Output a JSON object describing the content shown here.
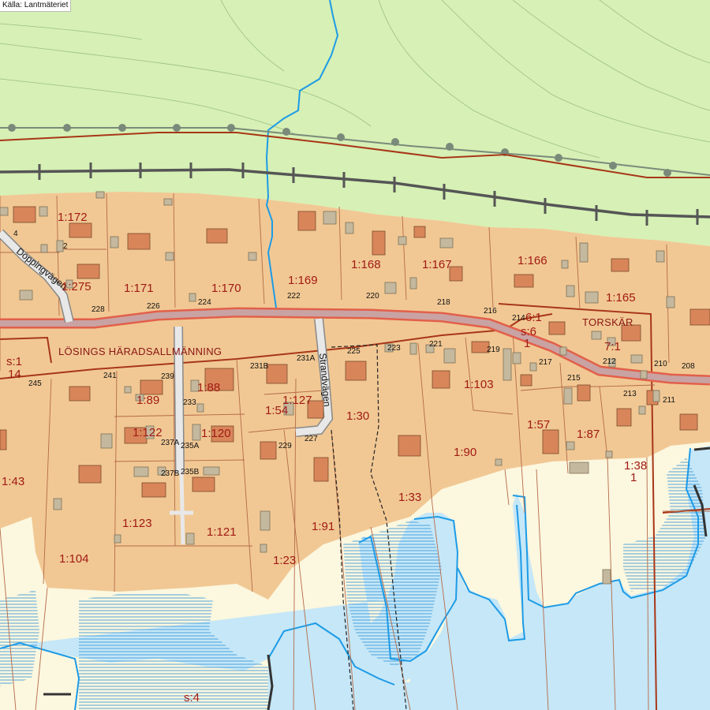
{
  "source_label": "Källa: Lantmäteriet",
  "colors": {
    "forest": "#d6f0b5",
    "plot": "#f1c894",
    "open_land": "#fcf7df",
    "water": "#c5e7f7",
    "stream": "#1d9be6",
    "main_road_fill": "#c9a3a3",
    "main_road_casing": "#e2604a",
    "boundary": "#a83618",
    "parcel_label": "#a01a14",
    "building": "#d9855a",
    "outbuilding": "#c4b89e"
  },
  "roads": {
    "doppingvagen": "Doppingvägen",
    "strandvagen": "Strandvägen"
  },
  "place_names": {
    "losings": "LÖSINGS HÄRADSALLMÄNNING",
    "torskar": "TORSKÄR"
  },
  "parcels": {
    "p172": "1:172",
    "p275": "1:275",
    "p171": "1:171",
    "p170": "1:170",
    "p169": "1:169",
    "p168": "1:168",
    "p167": "1:167",
    "p166": "1:166",
    "p165": "1:165",
    "p61": "6:1",
    "s6": "s:6",
    "s6_line2": "1",
    "p71": "7:1",
    "s1": "s:1",
    "s1_line2": "14",
    "p89": "1:89",
    "p88": "1:88",
    "p54": "1:54",
    "p127": "1:127",
    "p30": "1:30",
    "p103": "1:103",
    "p57": "1:57",
    "p87": "1:87",
    "p43": "1:43",
    "p122": "1:122",
    "p120": "1:120",
    "p90": "1:90",
    "p38": "1:38",
    "p38_line2": "1",
    "p33": "1:33",
    "p123": "1:123",
    "p121": "1:121",
    "p91": "1:91",
    "p104": "1:104",
    "p23": "1:23",
    "s4": "s:4"
  },
  "addresses": {
    "a4": "4",
    "a2": "2",
    "a228": "228",
    "a226": "226",
    "a224": "224",
    "a222": "222",
    "a220": "220",
    "a218": "218",
    "a216": "216",
    "a214": "214",
    "a212": "212",
    "a210": "210",
    "a208": "208",
    "a225": "225",
    "a223": "223",
    "a221": "221",
    "a219": "219",
    "a217": "217",
    "a215": "215",
    "a213": "213",
    "a211": "211",
    "a231b": "231B",
    "a231a": "231A",
    "a241": "241",
    "a239": "239",
    "a233": "233",
    "a245": "245",
    "a237a": "237A",
    "a235a": "235A",
    "a237b": "237B",
    "a235b": "235B",
    "a229": "229",
    "a227": "227"
  }
}
